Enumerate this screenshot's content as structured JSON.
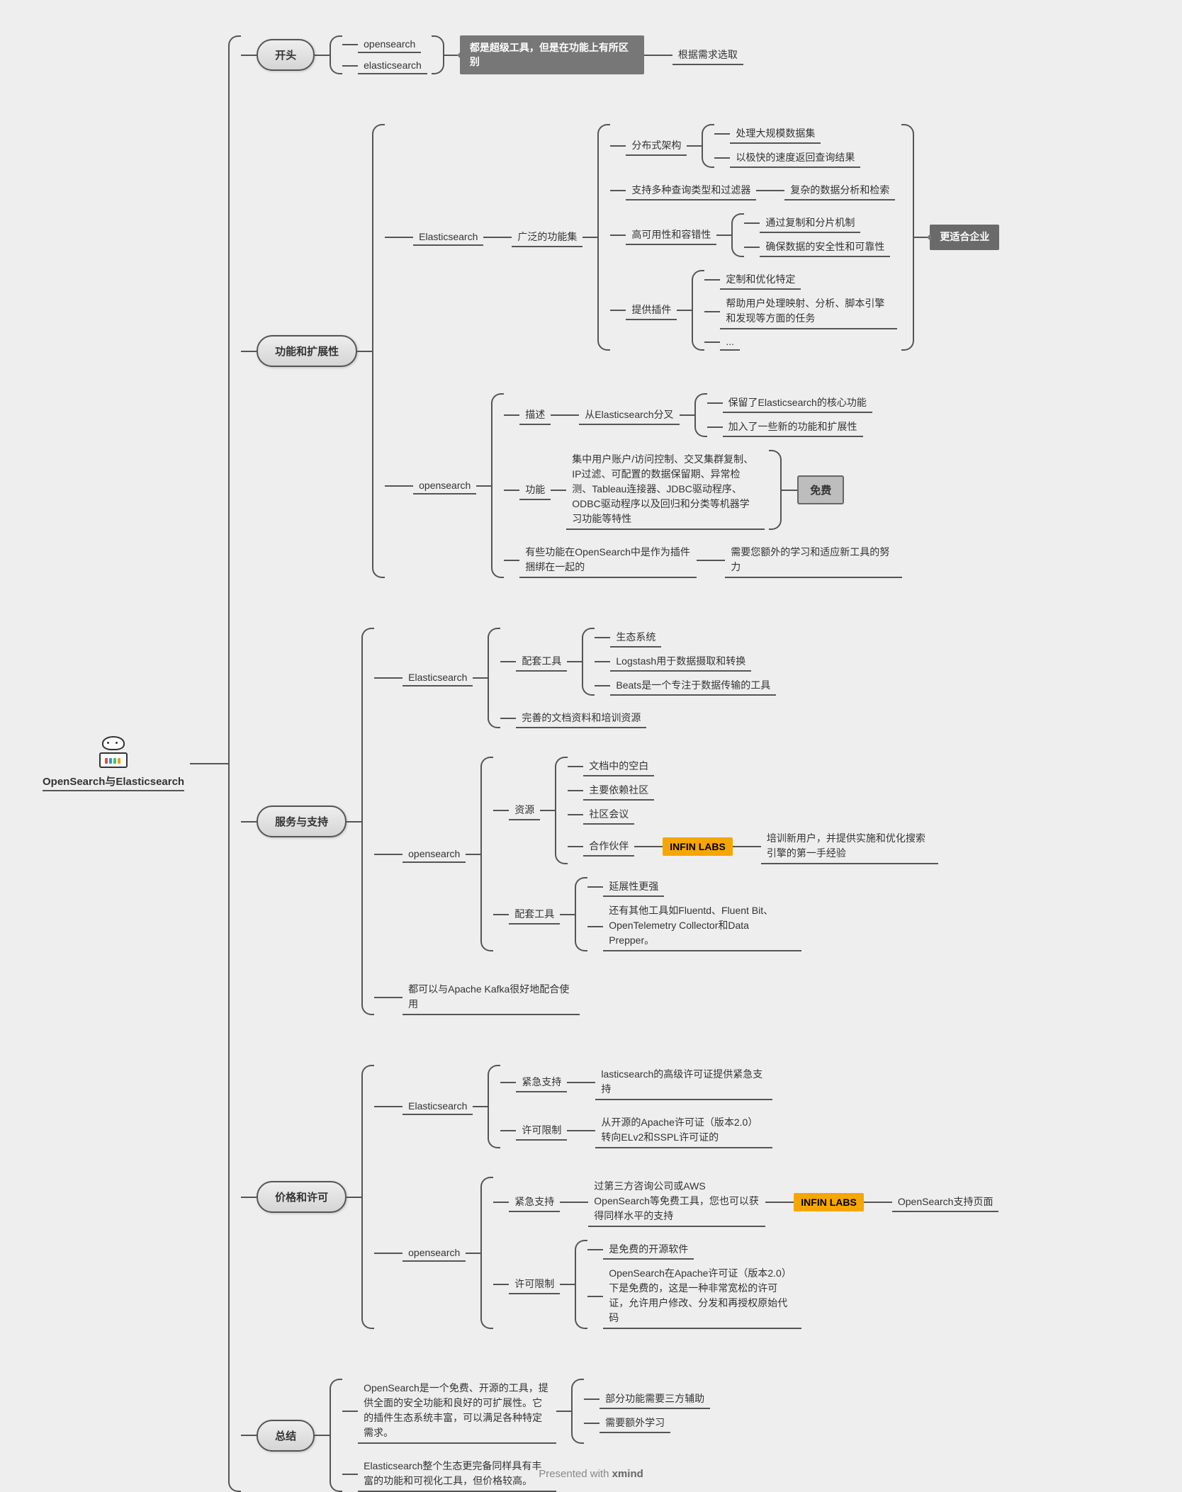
{
  "root": {
    "title": "OpenSearch与Elasticsearch"
  },
  "sec_intro": {
    "label": "开头",
    "a": "opensearch",
    "b": "elasticsearch",
    "callout": "都是超级工具，但是在功能上有所区别",
    "note": "根据需求选取"
  },
  "sec_func": {
    "label": "功能和扩展性",
    "es": {
      "label": "Elasticsearch",
      "featset": "广泛的功能集",
      "arch": "分布式架构",
      "arch_a": "处理大规模数据集",
      "arch_b": "以极快的速度返回查询结果",
      "query": "支持多种查询类型和过滤器",
      "query_sub": "复杂的数据分析和检索",
      "ha": "高可用性和容错性",
      "ha_a": "通过复制和分片机制",
      "ha_b": "确保数据的安全性和可靠性",
      "plugin": "提供插件",
      "plugin_a": "定制和优化特定",
      "plugin_b": "帮助用户处理映射、分析、脚本引擎和发现等方面的任务",
      "plugin_c": "...",
      "ent_callout": "更适合企业"
    },
    "os": {
      "label": "opensearch",
      "desc": "描述",
      "desc_from": "从Elasticsearch分叉",
      "desc_a": "保留了Elasticsearch的核心功能",
      "desc_b": "加入了一些新的功能和扩展性",
      "func": "功能",
      "func_detail": "集中用户账户/访问控制、交叉集群复制、IP过滤、可配置的数据保留期、异常检测、Tableau连接器、JDBC驱动程序、ODBC驱动程序以及回归和分类等机器学习功能等特性",
      "free": "免费",
      "bundle": "有些功能在OpenSearch中是作为插件捆绑在一起的",
      "bundle_note": "需要您额外的学习和适应新工具的努力"
    }
  },
  "sec_svc": {
    "label": "服务与支持",
    "es": {
      "label": "Elasticsearch",
      "tools": "配套工具",
      "tools_a": "生态系统",
      "tools_b": "Logstash用于数据摄取和转换",
      "tools_c": "Beats是一个专注于数据传输的工具",
      "docs": "完善的文档资料和培训资源"
    },
    "os": {
      "label": "opensearch",
      "res": "资源",
      "res_a": "文档中的空白",
      "res_b": "主要依赖社区",
      "res_c": "社区会议",
      "res_d": "合作伙伴",
      "hl": "INFIN LABS",
      "hl_note": "培训新用户，并提供实施和优化搜索引擎的第一手经验",
      "tools": "配套工具",
      "tools_a": "延展性更强",
      "tools_b": "还有其他工具如Fluentd、Fluent Bit、OpenTelemetry Collector和Data Prepper。"
    },
    "kafka": "都可以与Apache Kafka很好地配合使用"
  },
  "sec_price": {
    "label": "价格和许可",
    "es": {
      "label": "Elasticsearch",
      "support": "紧急支持",
      "support_a": "lasticsearch的高级许可证提供紧急支持",
      "lic": "许可限制",
      "lic_a": "从开源的Apache许可证（版本2.0）转向ELv2和SSPL许可证的"
    },
    "os": {
      "label": "opensearch",
      "support": "紧急支持",
      "support_a": "过第三方咨询公司或AWS OpenSearch等免费工具，您也可以获得同样水平的支持",
      "hl": "INFIN LABS",
      "hl_sub": "OpenSearch支持页面",
      "lic": "许可限制",
      "lic_a": "是免费的开源软件",
      "lic_b": "OpenSearch在Apache许可证（版本2.0）下是免费的，这是一种非常宽松的许可证，允许用户修改、分发和再授权原始代码"
    }
  },
  "sec_sum": {
    "label": "总结",
    "os": "OpenSearch是一个免费、开源的工具，提供全面的安全功能和良好的可扩展性。它的插件生态系统丰富，可以满足各种特定需求。",
    "os_a": "部分功能需要三方辅助",
    "os_b": "需要额外学习",
    "es": "Elasticsearch整个生态更完备同样具有丰富的功能和可视化工具，但价格较高。"
  },
  "footer": {
    "pre": "Presented with ",
    "brand": "xmind"
  }
}
